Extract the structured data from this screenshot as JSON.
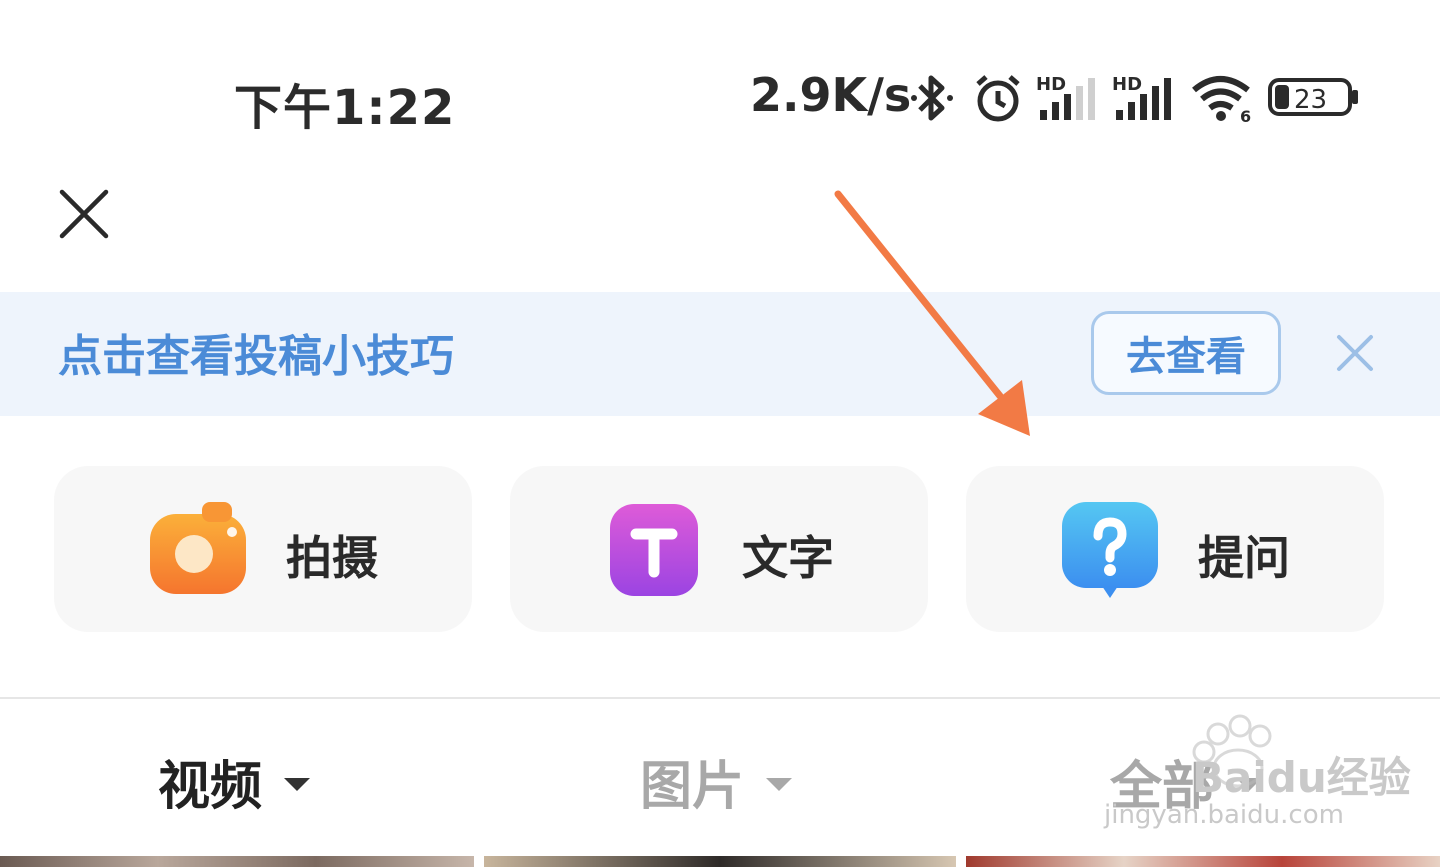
{
  "status_bar": {
    "time": "下午1:22",
    "net_speed": "2.9K/s",
    "battery": "23",
    "signal_label_1": "HD",
    "signal_label_2": "HD",
    "wifi_label": "6"
  },
  "tips_banner": {
    "text": "点击查看投稿小技巧",
    "button_label": "去查看"
  },
  "actions": [
    {
      "label": "拍摄",
      "icon": "camera-icon",
      "color": "#f7872f"
    },
    {
      "label": "文字",
      "icon": "text-t-icon",
      "color": "#b44ee0"
    },
    {
      "label": "提问",
      "icon": "question-bubble-icon",
      "color": "#3ea0f0"
    }
  ],
  "media_tabs": [
    {
      "label": "视频",
      "active": true
    },
    {
      "label": "图片",
      "active": false
    },
    {
      "label": "全部",
      "active": false
    }
  ],
  "watermark": {
    "brand": "Baidu经验",
    "url": "jingyan.baidu.com"
  },
  "colors": {
    "accent_blue": "#4b8bd7",
    "banner_bg": "#eef4fc",
    "annotation_arrow": "#f27a45"
  }
}
